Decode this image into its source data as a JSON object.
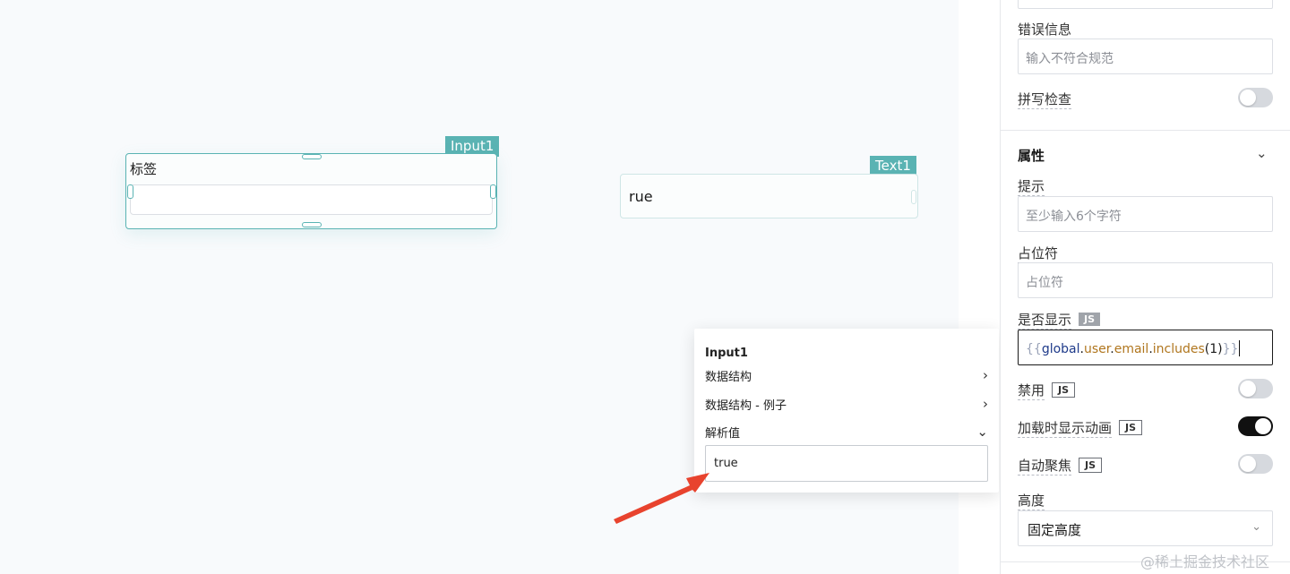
{
  "canvas": {
    "input_widget": {
      "tag": "Input1",
      "label": "标签"
    },
    "text_widget": {
      "tag": "Text1",
      "value": "rue"
    }
  },
  "popover": {
    "title": "Input1",
    "rows": [
      {
        "label": "数据结构",
        "chevron": "chevron-right-icon"
      },
      {
        "label": "数据结构 - 例子",
        "chevron": "chevron-right-icon"
      },
      {
        "label": "解析值",
        "chevron": "chevron-down-icon"
      }
    ],
    "result_value": "true"
  },
  "panel": {
    "error_info": {
      "label": "错误信息",
      "placeholder": "输入不符合规范"
    },
    "spellcheck": {
      "label": "拼写检查",
      "on": false
    },
    "attributes": {
      "title": "属性"
    },
    "hint": {
      "label": "提示",
      "placeholder": "至少输入6个字符"
    },
    "placeholder_field": {
      "label": "占位符",
      "placeholder": "占位符"
    },
    "visible": {
      "label": "是否显示",
      "badge": "JS",
      "code": {
        "open": "{{",
        "obj": "global",
        "dot1": ".",
        "p1": "user",
        "dot2": ".",
        "p2": "email",
        "dot3": ".",
        "p3": "includes",
        "args": "(1)",
        "close": "}}"
      }
    },
    "disabled": {
      "label": "禁用",
      "badge": "JS",
      "on": false
    },
    "loading_anim": {
      "label": "加载时显示动画",
      "badge": "JS",
      "on": true
    },
    "autofocus": {
      "label": "自动聚焦",
      "badge": "JS",
      "on": false
    },
    "height": {
      "label": "高度",
      "value": "固定高度"
    }
  },
  "watermark": "@稀土掘金技术社区",
  "colors": {
    "widget_accent": "#5ab3b3",
    "arrow": "#e8432e",
    "toggle_on": "#111111"
  }
}
